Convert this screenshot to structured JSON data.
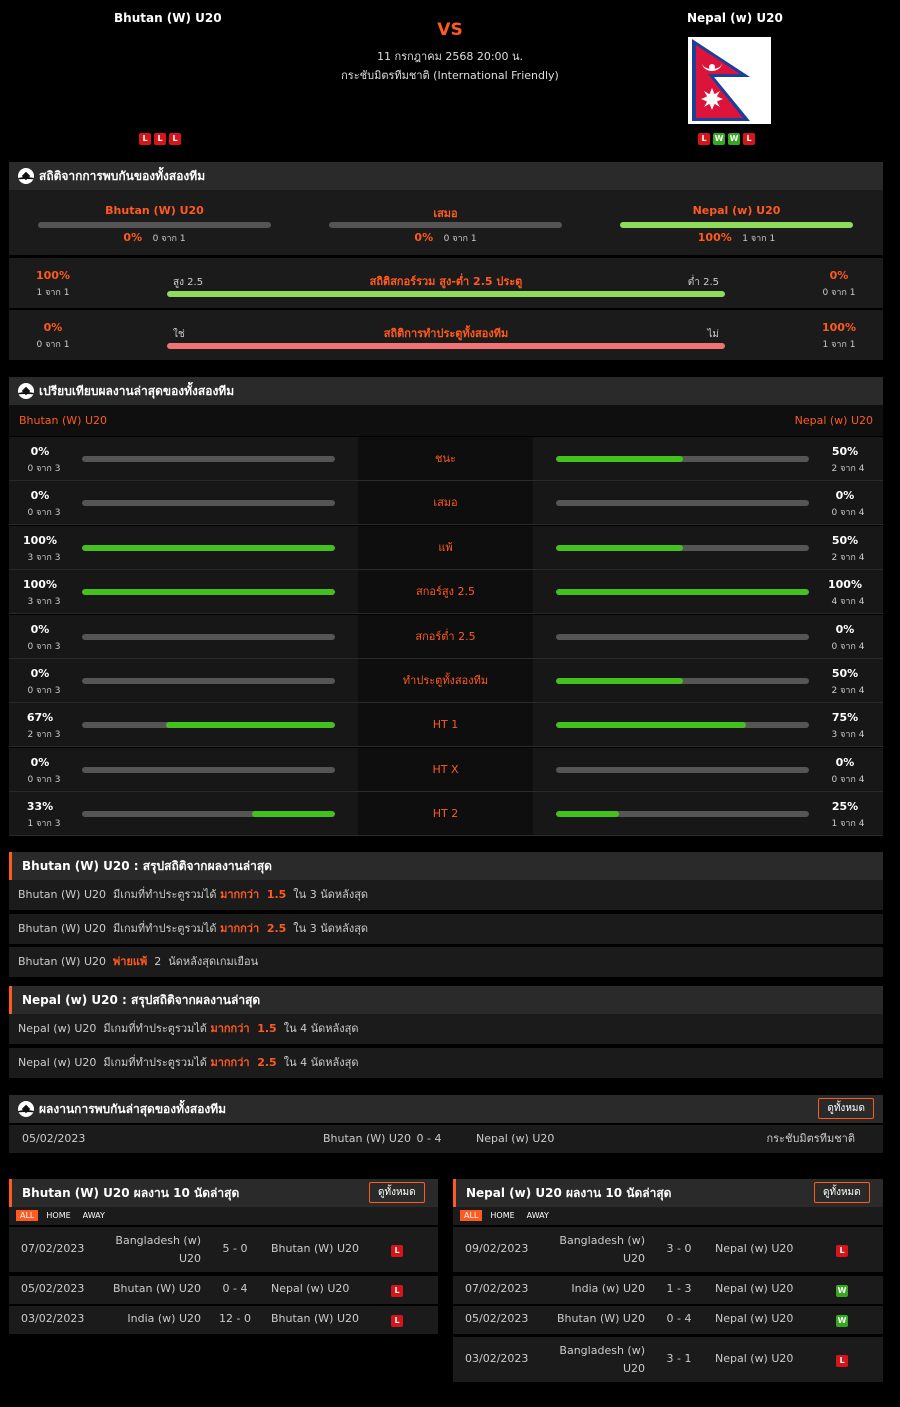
{
  "header": {
    "home_team": "Bhutan (W) U20",
    "away_team": "Nepal (w) U20",
    "vs": "VS",
    "date": "11 กรกฎาคม 2568 20:00 น.",
    "competition": "กระชับมิตรทีมชาติ (International Friendly)",
    "home_form": [
      "L",
      "L",
      "L"
    ],
    "away_form": [
      "L",
      "W",
      "W",
      "L"
    ]
  },
  "h2h_stats": {
    "title": "สถิติจากการพบกันของทั้งสองทีม",
    "home": {
      "label": "Bhutan (W) U20",
      "pct": "0%",
      "sub": "0 จาก 1"
    },
    "draw": {
      "label": "เสมอ",
      "pct": "0%",
      "sub": "0 จาก 1"
    },
    "away": {
      "label": "Nepal (w) U20",
      "pct": "100%",
      "sub": "1 จาก 1"
    },
    "over_under": {
      "title": "สถิติสกอร์รวม สูง-ต่ำ 2.5 ประตู",
      "left_pct": "100%",
      "left_sub": "1 จาก 1",
      "left_tag": "สูง 2.5",
      "right_pct": "0%",
      "right_sub": "0 จาก 1",
      "right_tag": "ต่ำ 2.5"
    },
    "btts": {
      "title": "สถิติการทำประตูทั้งสองทีม",
      "left_pct": "0%",
      "left_sub": "0 จาก 1",
      "left_tag": "ใช่",
      "right_pct": "100%",
      "right_sub": "1 จาก 1",
      "right_tag": "ไม่"
    }
  },
  "compare": {
    "title": "เปรียบเทียบผลงานล่าสุดของทั้งสองทีม",
    "home_label": "Bhutan (W) U20",
    "away_label": "Nepal (w) U20",
    "rows": [
      {
        "label": "ชนะ",
        "home_pct": "0%",
        "home_sub": "0 จาก 3",
        "home_fill": 0,
        "away_pct": "50%",
        "away_sub": "2 จาก 4",
        "away_fill": 0.5
      },
      {
        "label": "เสมอ",
        "home_pct": "0%",
        "home_sub": "0 จาก 3",
        "home_fill": 0,
        "away_pct": "0%",
        "away_sub": "0 จาก 4",
        "away_fill": 0
      },
      {
        "label": "แพ้",
        "home_pct": "100%",
        "home_sub": "3 จาก 3",
        "home_fill": 1,
        "away_pct": "50%",
        "away_sub": "2 จาก 4",
        "away_fill": 0.5
      },
      {
        "label": "สกอร์สูง 2.5",
        "home_pct": "100%",
        "home_sub": "3 จาก 3",
        "home_fill": 1,
        "away_pct": "100%",
        "away_sub": "4 จาก 4",
        "away_fill": 1
      },
      {
        "label": "สกอร์ต่ำ 2.5",
        "home_pct": "0%",
        "home_sub": "0 จาก 3",
        "home_fill": 0,
        "away_pct": "0%",
        "away_sub": "0 จาก 4",
        "away_fill": 0
      },
      {
        "label": "ทำประตูทั้งสองทีม",
        "home_pct": "0%",
        "home_sub": "0 จาก 3",
        "home_fill": 0,
        "away_pct": "50%",
        "away_sub": "2 จาก 4",
        "away_fill": 0.5
      },
      {
        "label": "HT 1",
        "home_pct": "67%",
        "home_sub": "2 จาก 3",
        "home_fill": 0.67,
        "away_pct": "75%",
        "away_sub": "3 จาก 4",
        "away_fill": 0.75
      },
      {
        "label": "HT X",
        "home_pct": "0%",
        "home_sub": "0 จาก 3",
        "home_fill": 0,
        "away_pct": "0%",
        "away_sub": "0 จาก 4",
        "away_fill": 0
      },
      {
        "label": "HT 2",
        "home_pct": "33%",
        "home_sub": "1 จาก 3",
        "home_fill": 0.33,
        "away_pct": "25%",
        "away_sub": "1 จาก 4",
        "away_fill": 0.25
      }
    ]
  },
  "home_summary": {
    "title": "Bhutan (W) U20 : สรุปสถิติจากผลงานล่าสุด",
    "rows": [
      {
        "pre": "Bhutan (W) U20  มีเกมที่ทำประตูรวมได้ ",
        "hl": "มากกว่า  1.5",
        "post": "  ใน 3 นัดหลังสุด"
      },
      {
        "pre": "Bhutan (W) U20  มีเกมที่ทำประตูรวมได้ ",
        "hl": "มากกว่า  2.5",
        "post": "  ใน 3 นัดหลังสุด"
      },
      {
        "pre": "Bhutan (W) U20  ",
        "hl": "พ่ายแพ้",
        "post": "  2  นัดหลังสุดเกมเยือน"
      }
    ]
  },
  "away_summary": {
    "title": "Nepal (w) U20 : สรุปสถิติจากผลงานล่าสุด",
    "rows": [
      {
        "pre": "Nepal (w) U20  มีเกมที่ทำประตูรวมได้ ",
        "hl": "มากกว่า  1.5",
        "post": "  ใน 4 นัดหลังสุด"
      },
      {
        "pre": "Nepal (w) U20  มีเกมที่ทำประตูรวมได้ ",
        "hl": "มากกว่า  2.5",
        "post": "  ใน 4 นัดหลังสุด"
      }
    ]
  },
  "h2h_results": {
    "title": "ผลงานการพบกันล่าสุดของทั้งสองทีม",
    "view_all": "ดูทั้งหมด",
    "rows": [
      {
        "date": "05/02/2023",
        "home": "Bhutan (W) U20",
        "score": "0 - 4",
        "away": "Nepal (w) U20",
        "comp": "กระชับมิตรทีมชาติ"
      }
    ]
  },
  "home_last10": {
    "title": "Bhutan (W) U20 ผลงาน 10 นัดล่าสุด",
    "view_all": "ดูทั้งหมด",
    "filters": [
      "ALL",
      "HOME",
      "AWAY"
    ],
    "rows": [
      {
        "date": "07/02/2023",
        "home": "Bangladesh (w) U20",
        "score": "5 - 0",
        "away": "Bhutan (W) U20",
        "result": "L"
      },
      {
        "date": "05/02/2023",
        "home": "Bhutan (W) U20",
        "score": "0 - 4",
        "away": "Nepal (w) U20",
        "result": "L"
      },
      {
        "date": "03/02/2023",
        "home": "India (w) U20",
        "score": "12 - 0",
        "away": "Bhutan (W) U20",
        "result": "L"
      }
    ]
  },
  "away_last10": {
    "title": "Nepal (w) U20 ผลงาน 10 นัดล่าสุด",
    "view_all": "ดูทั้งหมด",
    "filters": [
      "ALL",
      "HOME",
      "AWAY"
    ],
    "rows": [
      {
        "date": "09/02/2023",
        "home": "Bangladesh (w) U20",
        "score": "3 - 0",
        "away": "Nepal (w) U20",
        "result": "L"
      },
      {
        "date": "07/02/2023",
        "home": "India (w) U20",
        "score": "1 - 3",
        "away": "Nepal (w) U20",
        "result": "W"
      },
      {
        "date": "05/02/2023",
        "home": "Bhutan (W) U20",
        "score": "0 - 4",
        "away": "Nepal (w) U20",
        "result": "W"
      },
      {
        "date": "03/02/2023",
        "home": "Bangladesh (w) U20",
        "score": "3 - 1",
        "away": "Nepal (w) U20",
        "result": "L"
      }
    ]
  },
  "colors": {
    "accent": "#ff5a1f",
    "win": "#35a81f",
    "loss": "#d6151b",
    "bar_green": "#45c11d"
  }
}
